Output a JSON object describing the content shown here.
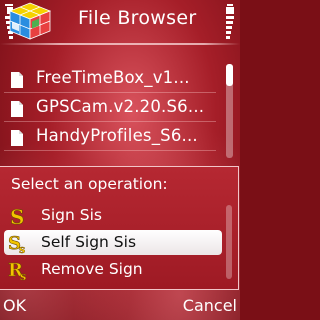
{
  "title_bar": {
    "title": "File Browser",
    "app_icon": "rubiks-cube-icon"
  },
  "file_list": {
    "items": [
      {
        "name": "FreeTimeBox_v1...",
        "icon": "document-icon"
      },
      {
        "name": "GPSCam.v2.20.S6...",
        "icon": "document-icon"
      },
      {
        "name": "HandyProfiles_S6...",
        "icon": "document-icon"
      }
    ]
  },
  "popup": {
    "title": "Select an operation:",
    "items": [
      {
        "label": "Sign Sis",
        "icon": "sign-sis-icon",
        "selected": false
      },
      {
        "label": "Self Sign Sis",
        "icon": "self-sign-icon",
        "selected": true
      },
      {
        "label": "Remove Sign",
        "icon": "remove-sign-icon",
        "selected": false
      }
    ]
  },
  "softkeys": {
    "left": "OK",
    "right": "Cancel"
  },
  "colors": {
    "background": "#a51e28",
    "highlight": "#ffffff",
    "icon_yellow": "#f2c400"
  }
}
